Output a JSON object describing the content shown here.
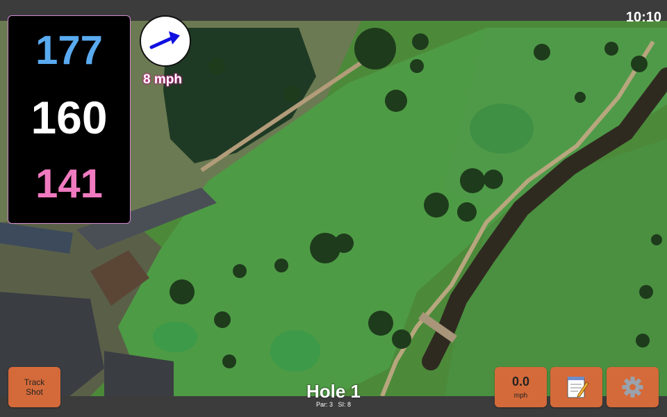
{
  "status": {
    "time": "10:10"
  },
  "distances": {
    "back": "177",
    "middle": "160",
    "front": "141"
  },
  "wind": {
    "speed": "8 mph",
    "icon": "wind-arrow-icon"
  },
  "buttons": {
    "track_shot_line1": "Track",
    "track_shot_line2": "Shot",
    "speed_value": "0.0",
    "speed_unit": "mph",
    "notes_icon": "notepad-icon",
    "settings_icon": "gear-icon"
  },
  "hole": {
    "title": "Hole 1",
    "par": "Par: 3",
    "si": "SI: 8"
  },
  "colors": {
    "accent_button": "#d46a3a",
    "back_distance": "#5aaaf0",
    "middle_distance": "#ffffff",
    "front_distance": "#f07ac0",
    "wind_arrow": "#1010e0"
  }
}
